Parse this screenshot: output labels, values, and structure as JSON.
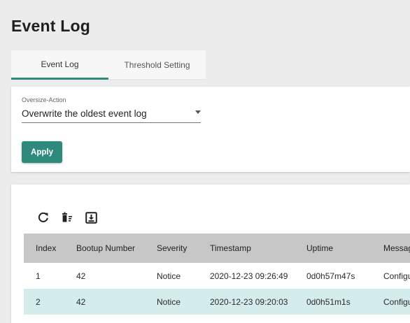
{
  "page": {
    "title": "Event Log"
  },
  "tabs": [
    {
      "label": "Event Log",
      "active": true
    },
    {
      "label": "Threshold Setting",
      "active": false
    }
  ],
  "settings": {
    "oversize_label": "Oversize-Action",
    "oversize_value": "Overwrite the oldest event log",
    "apply_label": "Apply"
  },
  "toolbar": {
    "icons": [
      "refresh-icon",
      "clear-log-icon",
      "export-icon"
    ]
  },
  "table": {
    "headers": [
      "Index",
      "Bootup Number",
      "Severity",
      "Timestamp",
      "Uptime",
      "Messag"
    ],
    "rows": [
      [
        "1",
        "42",
        "Notice",
        "2020-12-23 09:26:49",
        "0d0h57m47s",
        "Configu"
      ],
      [
        "2",
        "42",
        "Notice",
        "2020-12-23 09:20:03",
        "0d0h51m1s",
        "Configu"
      ]
    ]
  },
  "colors": {
    "accent": "#2f8a7e",
    "header_bg": "#c7c7c7",
    "selected_row_bg": "#d5ecec",
    "page_bg": "#ececec"
  }
}
